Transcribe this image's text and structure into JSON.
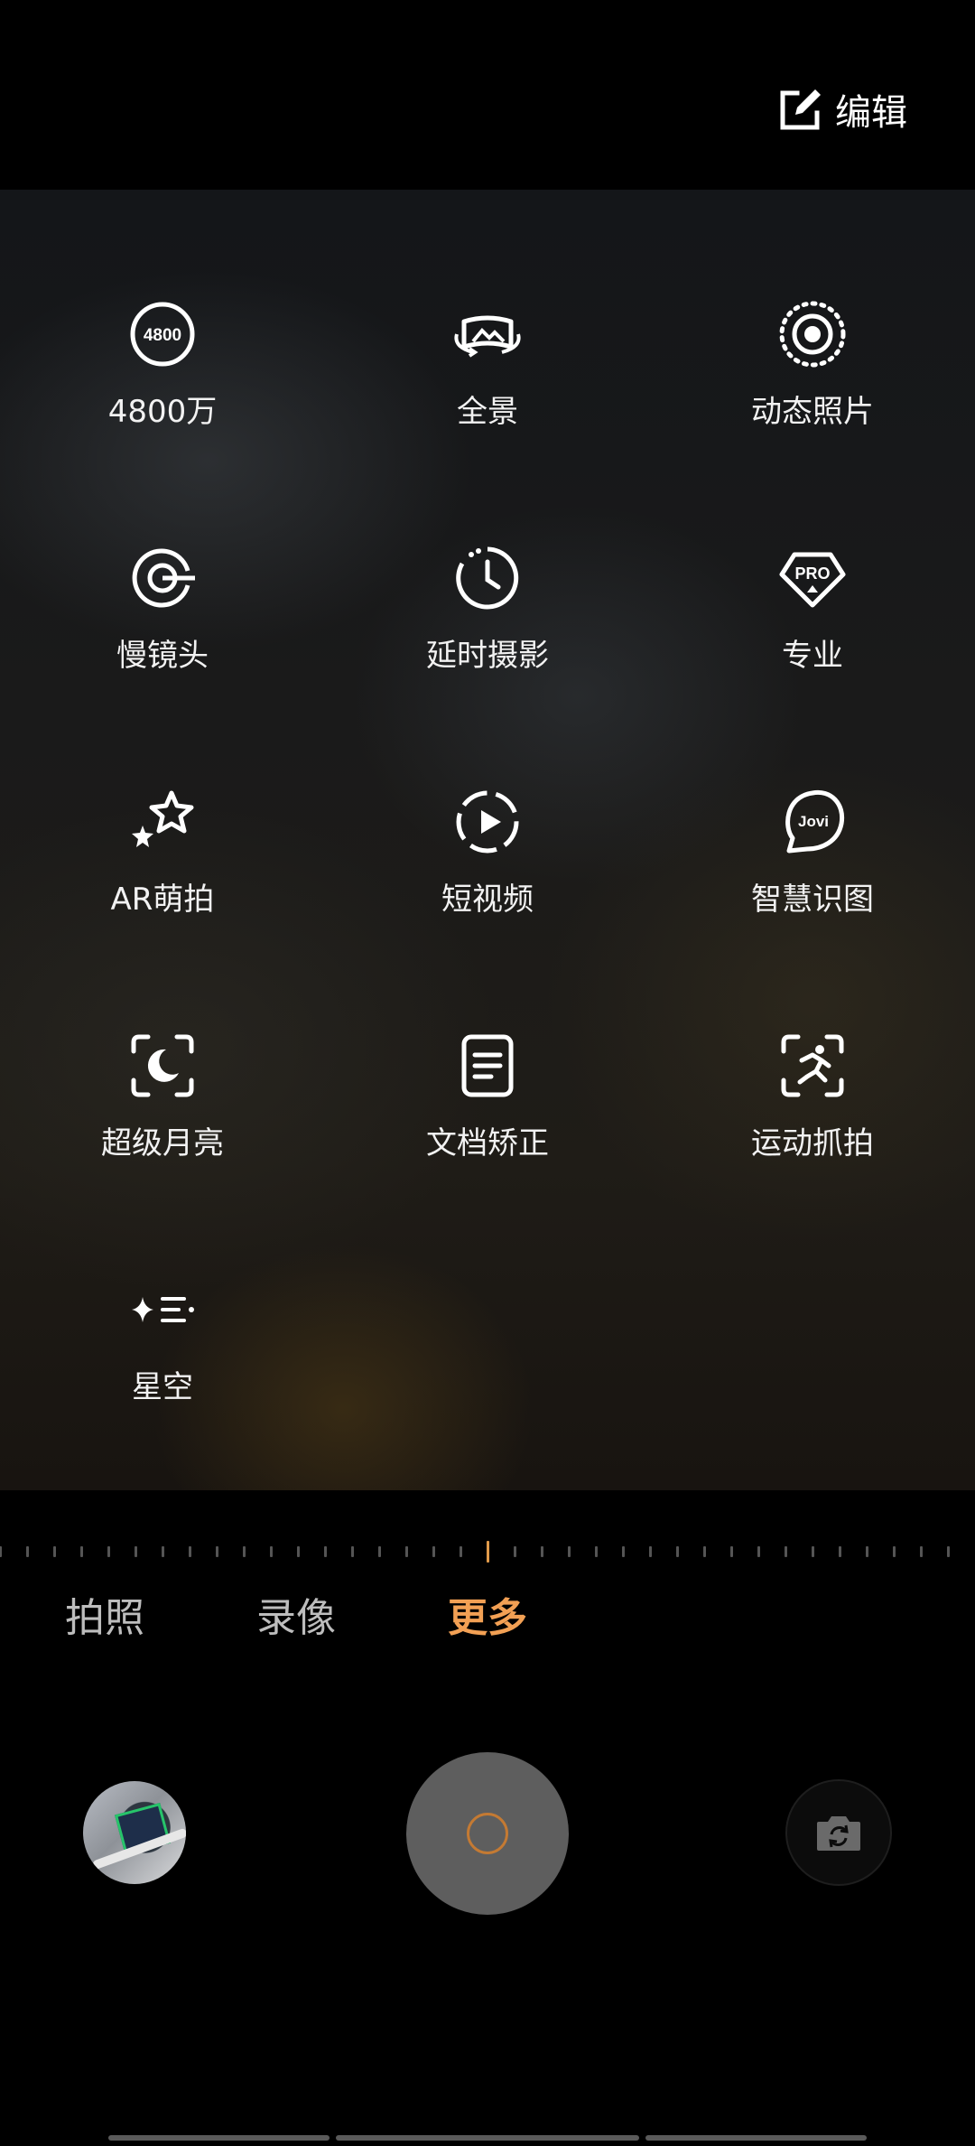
{
  "header": {
    "edit_label": "编辑"
  },
  "modes": [
    {
      "label": "4800万",
      "icon": "48mp-icon"
    },
    {
      "label": "全景",
      "icon": "panorama-icon"
    },
    {
      "label": "动态照片",
      "icon": "live-photo-icon"
    },
    {
      "label": "慢镜头",
      "icon": "slow-motion-icon"
    },
    {
      "label": "延时摄影",
      "icon": "time-lapse-icon"
    },
    {
      "label": "专业",
      "icon": "pro-icon"
    },
    {
      "label": "AR萌拍",
      "icon": "ar-stars-icon"
    },
    {
      "label": "短视频",
      "icon": "short-video-icon"
    },
    {
      "label": "智慧识图",
      "icon": "jovi-icon"
    },
    {
      "label": "超级月亮",
      "icon": "super-moon-icon"
    },
    {
      "label": "文档矫正",
      "icon": "document-icon"
    },
    {
      "label": "运动抓拍",
      "icon": "sport-snap-icon"
    },
    {
      "label": "星空",
      "icon": "starry-sky-icon"
    }
  ],
  "icon_texts": {
    "mp": "4800",
    "pro": "PRO",
    "jovi": "Jovi"
  },
  "tabs": [
    {
      "label": "拍照",
      "active": false
    },
    {
      "label": "录像",
      "active": false
    },
    {
      "label": "更多",
      "active": true
    }
  ],
  "colors": {
    "accent": "#f2a054",
    "shutter": "#5e5e5e"
  }
}
